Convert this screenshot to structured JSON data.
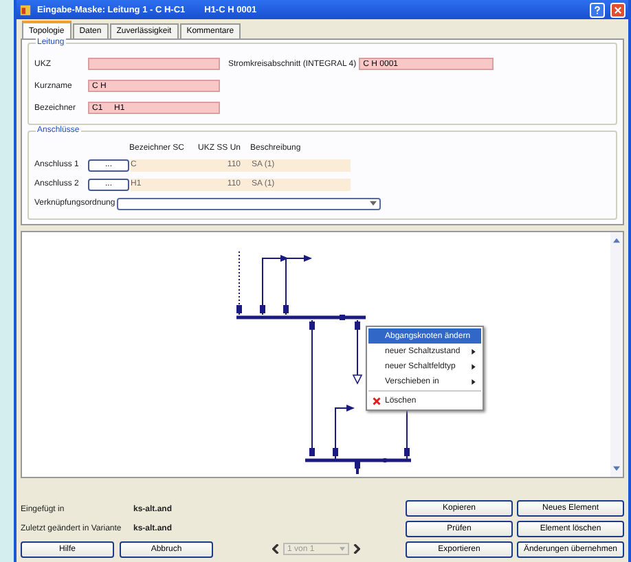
{
  "window": {
    "title": "Eingabe-Maske: Leitung 1 - C H-C1",
    "subtitle": "H1-C H 0001"
  },
  "tabs": [
    {
      "label": "Topologie",
      "selected": true
    },
    {
      "label": "Daten",
      "selected": false
    },
    {
      "label": "Zuverlässigkeit",
      "selected": false
    },
    {
      "label": "Kommentare",
      "selected": false
    }
  ],
  "leitung": {
    "legend": "Leitung",
    "ukz_label": "UKZ",
    "abschnitt_label": "Stromkreisabschnitt (INTEGRAL 4)",
    "abschnitt_value": "C H 0001",
    "kurzname_label": "Kurzname",
    "kurzname_value": "C H",
    "bezeichner_label": "Bezeichner",
    "bezeichner_value": "C1     H1"
  },
  "anschluesse": {
    "legend": "Anschlüsse",
    "columns": [
      "Bezeichner SC",
      "UKZ SS Un",
      "Beschreibung"
    ],
    "rows": [
      {
        "label": "Anschluss 1",
        "button": "...",
        "bezeichner": "C",
        "un": "110",
        "beschreibung": "SA (1)"
      },
      {
        "label": "Anschluss 2",
        "button": "...",
        "bezeichner": "H1",
        "un": "110",
        "beschreibung": "SA (1)"
      }
    ],
    "order_label": "Verknüpfungsordnung"
  },
  "context_menu": [
    {
      "kind": "action",
      "label": "Abgangsknoten ändern",
      "selected": true
    },
    {
      "kind": "submenu",
      "label": "neuer Schaltzustand",
      "selected": false
    },
    {
      "kind": "submenu",
      "label": "neuer Schaltfeldtyp",
      "selected": false
    },
    {
      "kind": "submenu",
      "label": "Verschieben in",
      "selected": false
    },
    {
      "kind": "delete",
      "label": "Löschen",
      "selected": false
    }
  ],
  "info": [
    {
      "label": "Eingefügt in",
      "value": "ks-alt.and"
    },
    {
      "label": "Zuletzt geändert in Variante",
      "value": "ks-alt.and"
    }
  ],
  "left_buttons": [
    "Hilfe",
    "Abbruch"
  ],
  "pager": {
    "value": "1 von 1"
  },
  "right_buttons": [
    "Kopieren",
    "Neues Element",
    "Prüfen",
    "Element löschen",
    "Exportieren",
    "Änderungen übernehmen"
  ]
}
